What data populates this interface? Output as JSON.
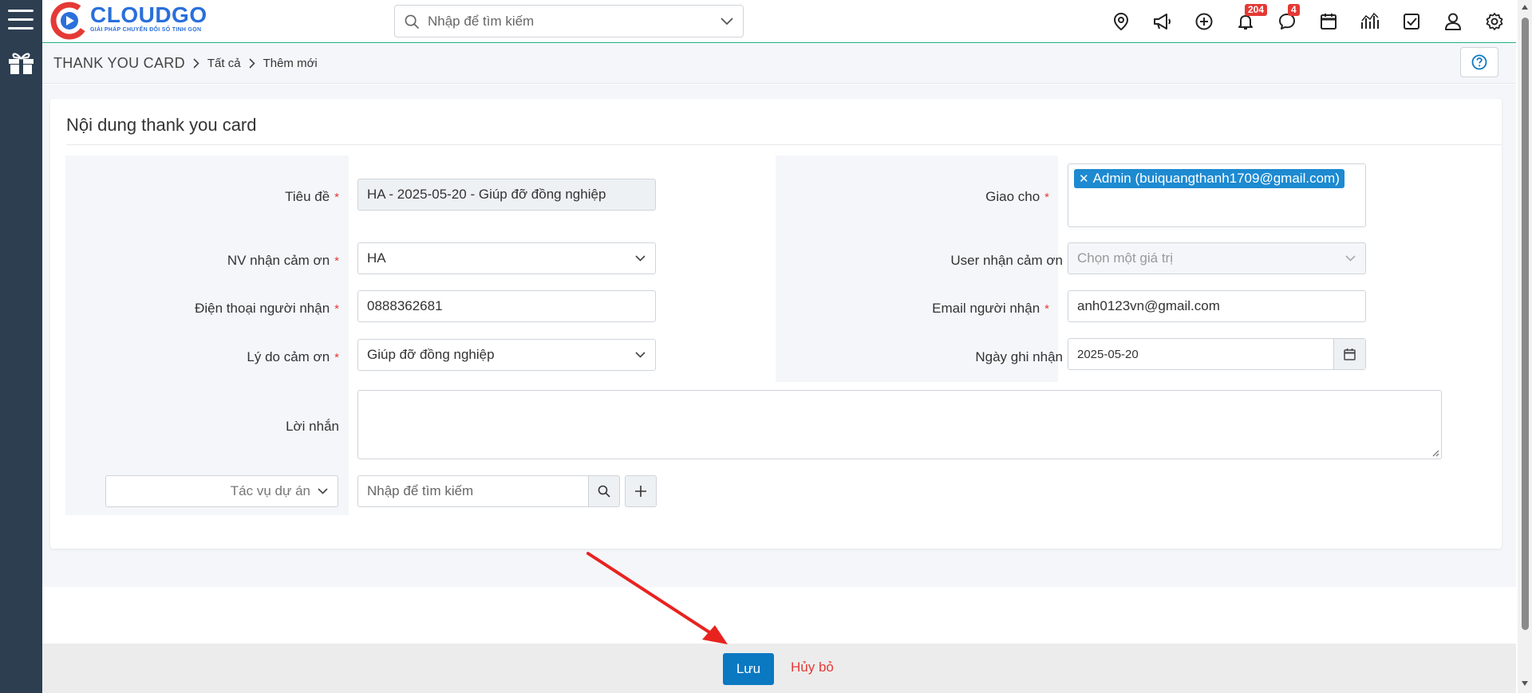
{
  "app": {
    "logo_name": "CLOUDGO",
    "logo_tagline": "GIẢI PHÁP CHUYỂN ĐỔI SỐ TINH GỌN"
  },
  "search": {
    "placeholder": "Nhập để tìm kiếm"
  },
  "header_icons": [
    {
      "name": "location-icon"
    },
    {
      "name": "megaphone-icon"
    },
    {
      "name": "plus-circle-icon"
    },
    {
      "name": "bell-icon",
      "badge": "204"
    },
    {
      "name": "chat-icon",
      "badge": "4"
    },
    {
      "name": "calendar-icon"
    },
    {
      "name": "chart-icon"
    },
    {
      "name": "checkbox-icon"
    },
    {
      "name": "user-icon"
    },
    {
      "name": "settings-icon"
    }
  ],
  "breadcrumb": {
    "root": "THANK YOU CARD",
    "items": [
      "Tất cả",
      "Thêm mới"
    ]
  },
  "card": {
    "title": "Nội dung thank you card"
  },
  "form": {
    "title": {
      "label": "Tiêu đề",
      "value": "HA - 2025-05-20 - Giúp đỡ đồng nghiệp"
    },
    "assignee": {
      "label": "Giao cho",
      "tag": "Admin (buiquangthanh1709@gmail.com)"
    },
    "employee": {
      "label": "NV nhận cảm ơn",
      "value": "HA"
    },
    "user": {
      "label": "User nhận cảm ơn",
      "placeholder": "Chọn một giá trị"
    },
    "phone": {
      "label": "Điện thoại người nhận",
      "value": "0888362681"
    },
    "email": {
      "label": "Email người nhận",
      "value": "anh0123vn@gmail.com"
    },
    "reason": {
      "label": "Lý do cảm ơn",
      "value": "Giúp đỡ đồng nghiệp"
    },
    "date": {
      "label": "Ngày ghi nhận",
      "value": "2025-05-20"
    },
    "message": {
      "label": "Lời nhắn",
      "value": ""
    },
    "task": {
      "label": "Tác vụ dự án",
      "search_placeholder": "Nhập để tìm kiếm"
    },
    "required_mark": "*"
  },
  "footer": {
    "save_label": "Lưu",
    "cancel_label": "Hủy bỏ"
  },
  "colors": {
    "primary": "#0b78c2",
    "accent_line": "#1dad7f",
    "danger": "#e53935",
    "tag_bg": "#1d8ad1",
    "rail": "#2c3e50"
  }
}
